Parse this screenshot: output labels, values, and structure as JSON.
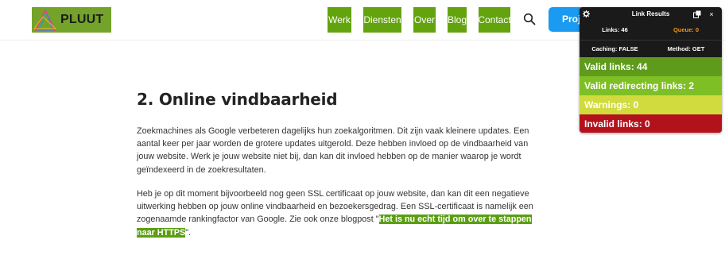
{
  "header": {
    "logo_text": "PLUUT",
    "nav": [
      "Werk",
      "Diensten",
      "Over",
      "Blog",
      "Contact"
    ],
    "cta_label": "Proj"
  },
  "article": {
    "heading": "2. Online vindbaarheid",
    "p1": "Zoekmachines als Google verbeteren dagelijks hun zoekalgoritmen. Dit zijn vaak kleinere updates. Een aantal keer per jaar worden de grotere updates uitgerold. Deze hebben invloed op de vindbaarheid van jouw website. Werk je jouw website niet bij, dan kan dit invloed hebben op de manier waarop je wordt geïndexeerd in de zoekresultaten.",
    "p2_before": "Heb je op dit moment bijvoorbeeld nog geen SSL certificaat op jouw website, dan kan dit een negatieve uitwerking hebben op jouw online vindbaarheid en bezoekersgedrag. Een SSL-certificaat is namelijk een zogenaamde rankingfactor van Google. Zie ook onze blogpost \"",
    "p2_link": "Het is nu echt tijd om over te stappen naar HTTPS",
    "p2_after": "\"."
  },
  "link_results": {
    "title": "Link Results",
    "links": "Links: 46",
    "queue": "Queue: 0",
    "caching": "Caching: FALSE",
    "method": "Method: GET",
    "valid": "Valid links: 44",
    "redirecting": "Valid redirecting links: 2",
    "warnings": "Warnings: 0",
    "invalid": "Invalid links: 0",
    "close_glyph": "×"
  },
  "colors": {
    "brand_green": "#63a30e",
    "cta_blue": "#1a9af0",
    "valid": "#5f9b1b",
    "redirecting": "#7fbf26",
    "warnings": "#d2db3d",
    "invalid": "#b3121c",
    "queue": "#f2961c"
  },
  "icons": [
    "logo-mark-icon",
    "search-icon",
    "gear-icon",
    "export-icon",
    "close-icon"
  ]
}
